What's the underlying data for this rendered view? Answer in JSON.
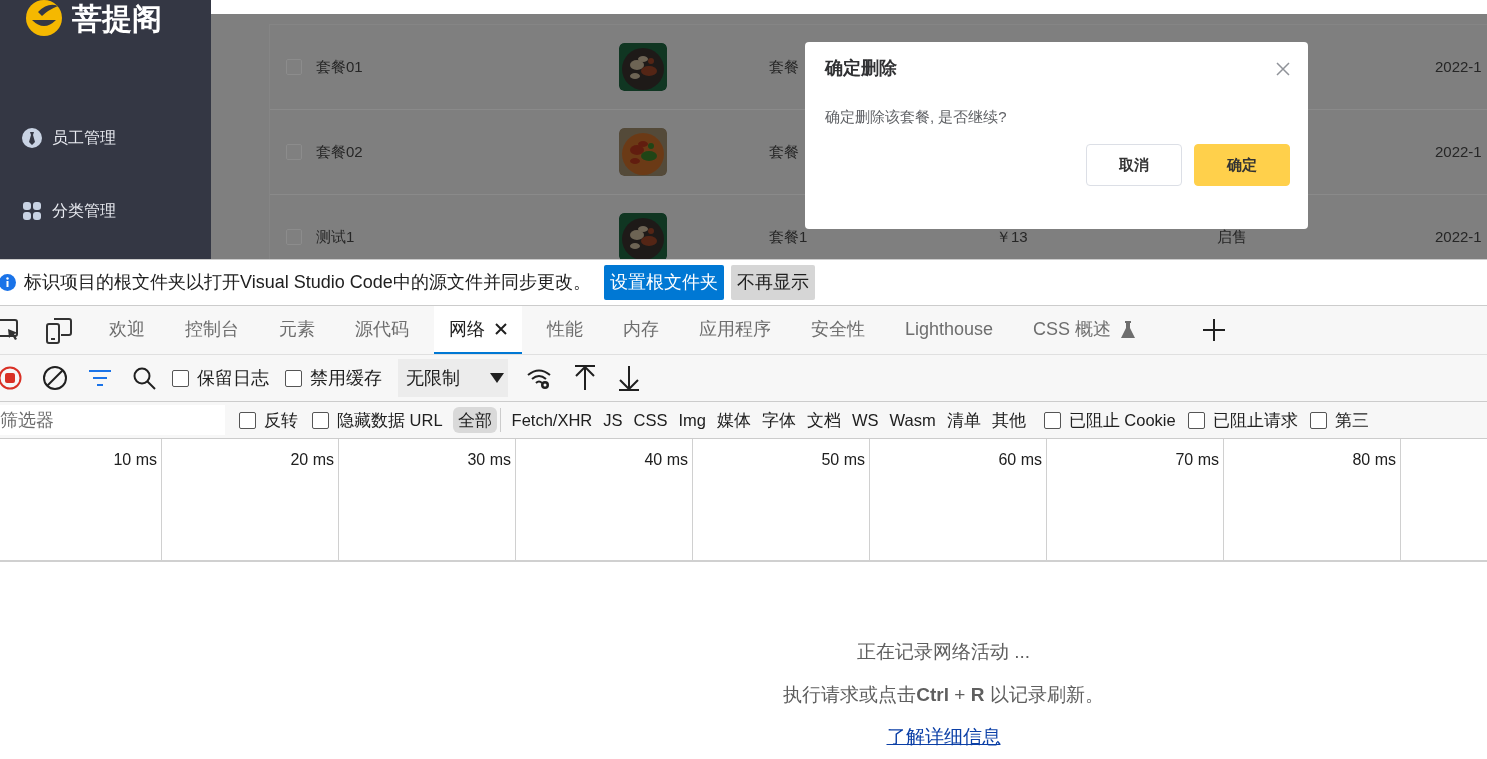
{
  "sidebar": {
    "logo": "菩提阁",
    "items": [
      {
        "label": "员工管理"
      },
      {
        "label": "分类管理"
      }
    ]
  },
  "table": {
    "rows": [
      {
        "checked": false,
        "name": "套餐01",
        "category": "套餐",
        "date": "2022-1"
      },
      {
        "checked": false,
        "name": "套餐02",
        "category": "套餐",
        "date": "2022-1"
      },
      {
        "checked": false,
        "name": "测试1",
        "category": "套餐1",
        "price": "￥13",
        "status": "启售",
        "date": "2022-1"
      }
    ]
  },
  "dialog": {
    "title": "确定删除",
    "message": "确定删除该套餐, 是否继续?",
    "buttons": [
      {
        "label": "取消",
        "kind": "secondary"
      },
      {
        "label": "确定",
        "kind": "primary"
      }
    ]
  },
  "devtools": {
    "infobar": {
      "message": "标识项目的根文件夹以打开Visual Studio Code中的源文件并同步更改。",
      "buttons": [
        {
          "label": "设置根文件夹",
          "kind": "primary"
        },
        {
          "label": "不再显示",
          "kind": "secondary"
        }
      ]
    },
    "tabs": [
      {
        "label": "欢迎",
        "selected": false,
        "experimental": false
      },
      {
        "label": "控制台",
        "selected": false,
        "experimental": false
      },
      {
        "label": "元素",
        "selected": false,
        "experimental": false
      },
      {
        "label": "源代码",
        "selected": false,
        "experimental": false
      },
      {
        "label": "网络",
        "selected": true,
        "experimental": false
      },
      {
        "label": "性能",
        "selected": false,
        "experimental": false
      },
      {
        "label": "内存",
        "selected": false,
        "experimental": false
      },
      {
        "label": "应用程序",
        "selected": false,
        "experimental": false
      },
      {
        "label": "安全性",
        "selected": false,
        "experimental": false
      },
      {
        "label": "Lighthouse",
        "selected": false,
        "experimental": false
      },
      {
        "label": "CSS 概述",
        "selected": false,
        "experimental": true
      }
    ],
    "toolbar": {
      "recording": true,
      "checkboxes": [
        {
          "label": "保留日志",
          "checked": false
        },
        {
          "label": "禁用缓存",
          "checked": false
        }
      ],
      "throttling": "无限制"
    },
    "filter": {
      "placeholder": "筛选器",
      "options": [
        {
          "label": "反转",
          "checked": false
        },
        {
          "label": "隐藏数据 URL",
          "checked": false
        }
      ],
      "types": [
        {
          "label": "全部",
          "selected": true
        },
        {
          "label": "Fetch/XHR",
          "selected": false
        },
        {
          "label": "JS",
          "selected": false
        },
        {
          "label": "CSS",
          "selected": false
        },
        {
          "label": "Img",
          "selected": false
        },
        {
          "label": "媒体",
          "selected": false
        },
        {
          "label": "字体",
          "selected": false
        },
        {
          "label": "文档",
          "selected": false
        },
        {
          "label": "WS",
          "selected": false
        },
        {
          "label": "Wasm",
          "selected": false
        },
        {
          "label": "清单",
          "selected": false
        },
        {
          "label": "其他",
          "selected": false
        }
      ],
      "blocking": [
        {
          "label": "已阻止 Cookie",
          "checked": false
        },
        {
          "label": "已阻止请求",
          "checked": false
        },
        {
          "label": "第三",
          "checked": false
        }
      ]
    },
    "timeline": {
      "ticks": [
        "10 ms",
        "20 ms",
        "30 ms",
        "40 ms",
        "50 ms",
        "60 ms",
        "70 ms",
        "80 ms"
      ]
    },
    "empty_state": {
      "lines": [
        "正在记录网络活动 ...",
        "执行请求或点击**Ctrl** + **R** 以记录刷新。"
      ],
      "link": "了解详细信息"
    }
  }
}
